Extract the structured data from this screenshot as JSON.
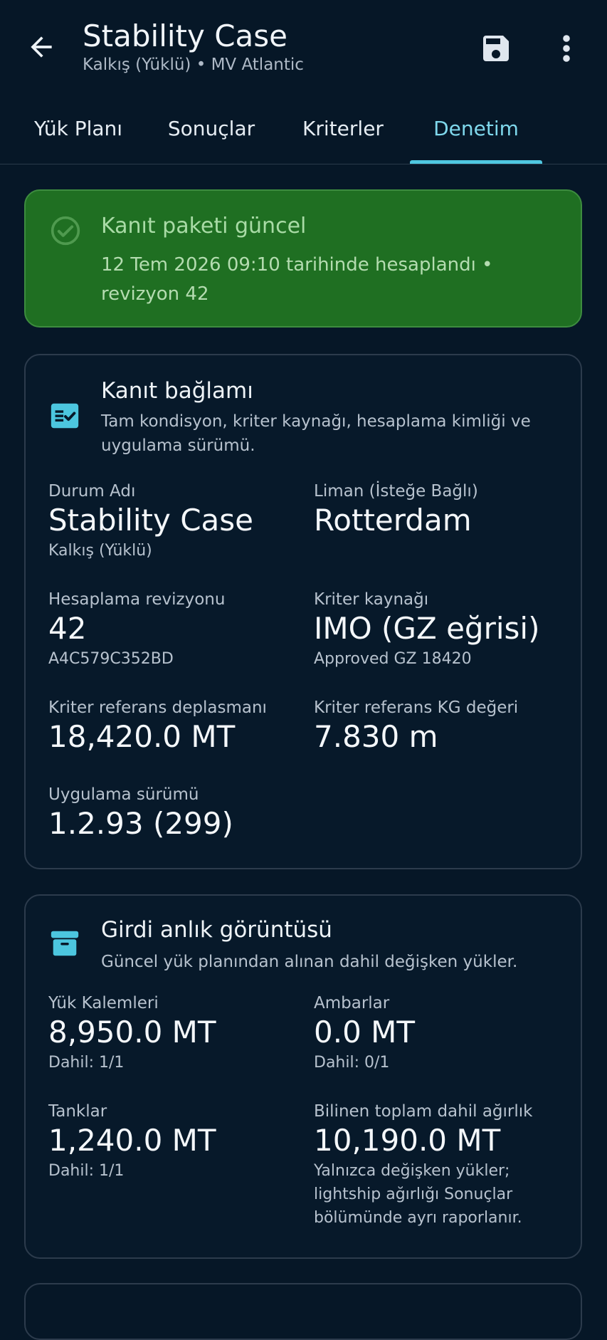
{
  "header": {
    "title": "Stability Case",
    "subtitle": "Kalkış (Yüklü) • MV Atlantic"
  },
  "tabs": [
    {
      "label": "Yük Planı",
      "active": false
    },
    {
      "label": "Sonuçlar",
      "active": false
    },
    {
      "label": "Kriterler",
      "active": false
    },
    {
      "label": "Denetim",
      "active": true
    }
  ],
  "status": {
    "title": "Kanıt paketi güncel",
    "subtitle": "12 Tem 2026 09:10 tarihinde hesaplandı • revizyon 42",
    "icon": "check-circle-icon"
  },
  "evidence": {
    "title": "Kanıt bağlamı",
    "description": "Tam kondisyon, kriter kaynağı, hesaplama kimliği ve uygulama sürümü.",
    "icon": "fact-check-icon",
    "fields": [
      {
        "label": "Durum Adı",
        "value": "Stability Case",
        "sub": "Kalkış (Yüklü)"
      },
      {
        "label": "Liman (İsteğe Bağlı)",
        "value": "Rotterdam",
        "sub": ""
      },
      {
        "label": "Hesaplama revizyonu",
        "value": "42",
        "sub": "A4C579C352BD"
      },
      {
        "label": "Kriter kaynağı",
        "value": "IMO (GZ eğrisi)",
        "sub": "Approved GZ 18420"
      },
      {
        "label": "Kriter referans deplasmanı",
        "value": "18,420.0 MT",
        "sub": ""
      },
      {
        "label": "Kriter referans KG değeri",
        "value": "7.830 m",
        "sub": ""
      },
      {
        "label": "Uygulama sürümü",
        "value": "1.2.93 (299)",
        "sub": ""
      }
    ]
  },
  "snapshot": {
    "title": "Girdi anlık görüntüsü",
    "description": "Güncel yük planından alınan dahil değişken yükler.",
    "icon": "archive-icon",
    "fields": [
      {
        "label": "Yük Kalemleri",
        "value": "8,950.0 MT",
        "sub": "Dahil: 1/1"
      },
      {
        "label": "Ambarlar",
        "value": "0.0 MT",
        "sub": "Dahil: 0/1"
      },
      {
        "label": "Tanklar",
        "value": "1,240.0 MT",
        "sub": "Dahil: 1/1"
      },
      {
        "label": "Bilinen toplam dahil ağırlık",
        "value": "10,190.0 MT",
        "sub": "Yalnızca değişken yükler; lightship ağırlığı Sonuçlar bölümünde ayrı raporlanır."
      }
    ]
  },
  "colors": {
    "background": "#061727",
    "accent": "#4fc7e0",
    "status_green": "#1f6f22"
  }
}
